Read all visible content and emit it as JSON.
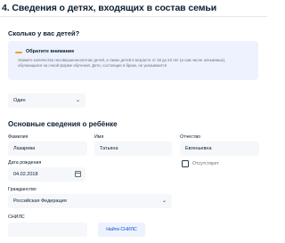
{
  "section": {
    "title": "4. Сведения о детях, входящих в состав семьи"
  },
  "children_count": {
    "question": "Сколько у вас детей?",
    "notice_title": "Обратите внимание",
    "notice_text": "Укажите количество несовершеннолетних детей, а также детей в возрасте от 18 до 23 лет (и сам числе опекаемых), обучающихся на очной форме обучения. Дети, состоящие в браке, не указываются",
    "selected": "Один"
  },
  "child_info": {
    "title": "Основные сведения о ребёнке",
    "surname_label": "Фамилия",
    "surname_value": "Лазарева",
    "name_label": "Имя",
    "name_value": "Татьяна",
    "patronymic_label": "Отчество",
    "patronymic_value": "Евгеньевна",
    "no_patronymic_label": "Отсутствует",
    "no_patronymic_checked": false,
    "birthdate_label": "Дата рождения",
    "birthdate_value": "04.02.2018",
    "citizenship_label": "Гражданство",
    "citizenship_value": "Российская Федерация",
    "snils_label": "СНИЛС",
    "snils_value": "",
    "find_snils_button": "Найти СНИЛС"
  },
  "icons": {
    "calendar": "calendar-icon",
    "chevron": "chevron-down-icon",
    "notice_marker": "warning-bar-icon"
  },
  "colors": {
    "accent": "#0d4cd3",
    "notice_bg": "#edf2fe",
    "notice_marker": "#e9a233",
    "field_bg": "#f5f7fa"
  }
}
